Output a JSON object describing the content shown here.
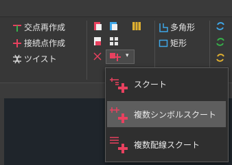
{
  "ribbon": {
    "group1": {
      "items": [
        {
          "label": "交点再作成",
          "icon": "intersection-icon"
        },
        {
          "label": "接続点作成",
          "icon": "connection-point-icon"
        },
        {
          "label": "ツイスト",
          "icon": "twist-icon"
        }
      ]
    },
    "group3": {
      "items": [
        {
          "label": "多角形",
          "icon": "polygon-icon"
        },
        {
          "label": "矩形",
          "icon": "rectangle-icon"
        }
      ]
    }
  },
  "menu": {
    "items": [
      {
        "label": "スクート",
        "icon": "skoot-icon"
      },
      {
        "label": "複数シンボルスクート",
        "icon": "multi-symbol-skoot-icon",
        "highlighted": true
      },
      {
        "label": "複数配線スクート",
        "icon": "multi-wire-skoot-icon"
      }
    ]
  },
  "colors": {
    "accent": "#e8415f",
    "blue": "#3fa7e8",
    "yellow": "#e0b030",
    "green": "#36b24a"
  }
}
